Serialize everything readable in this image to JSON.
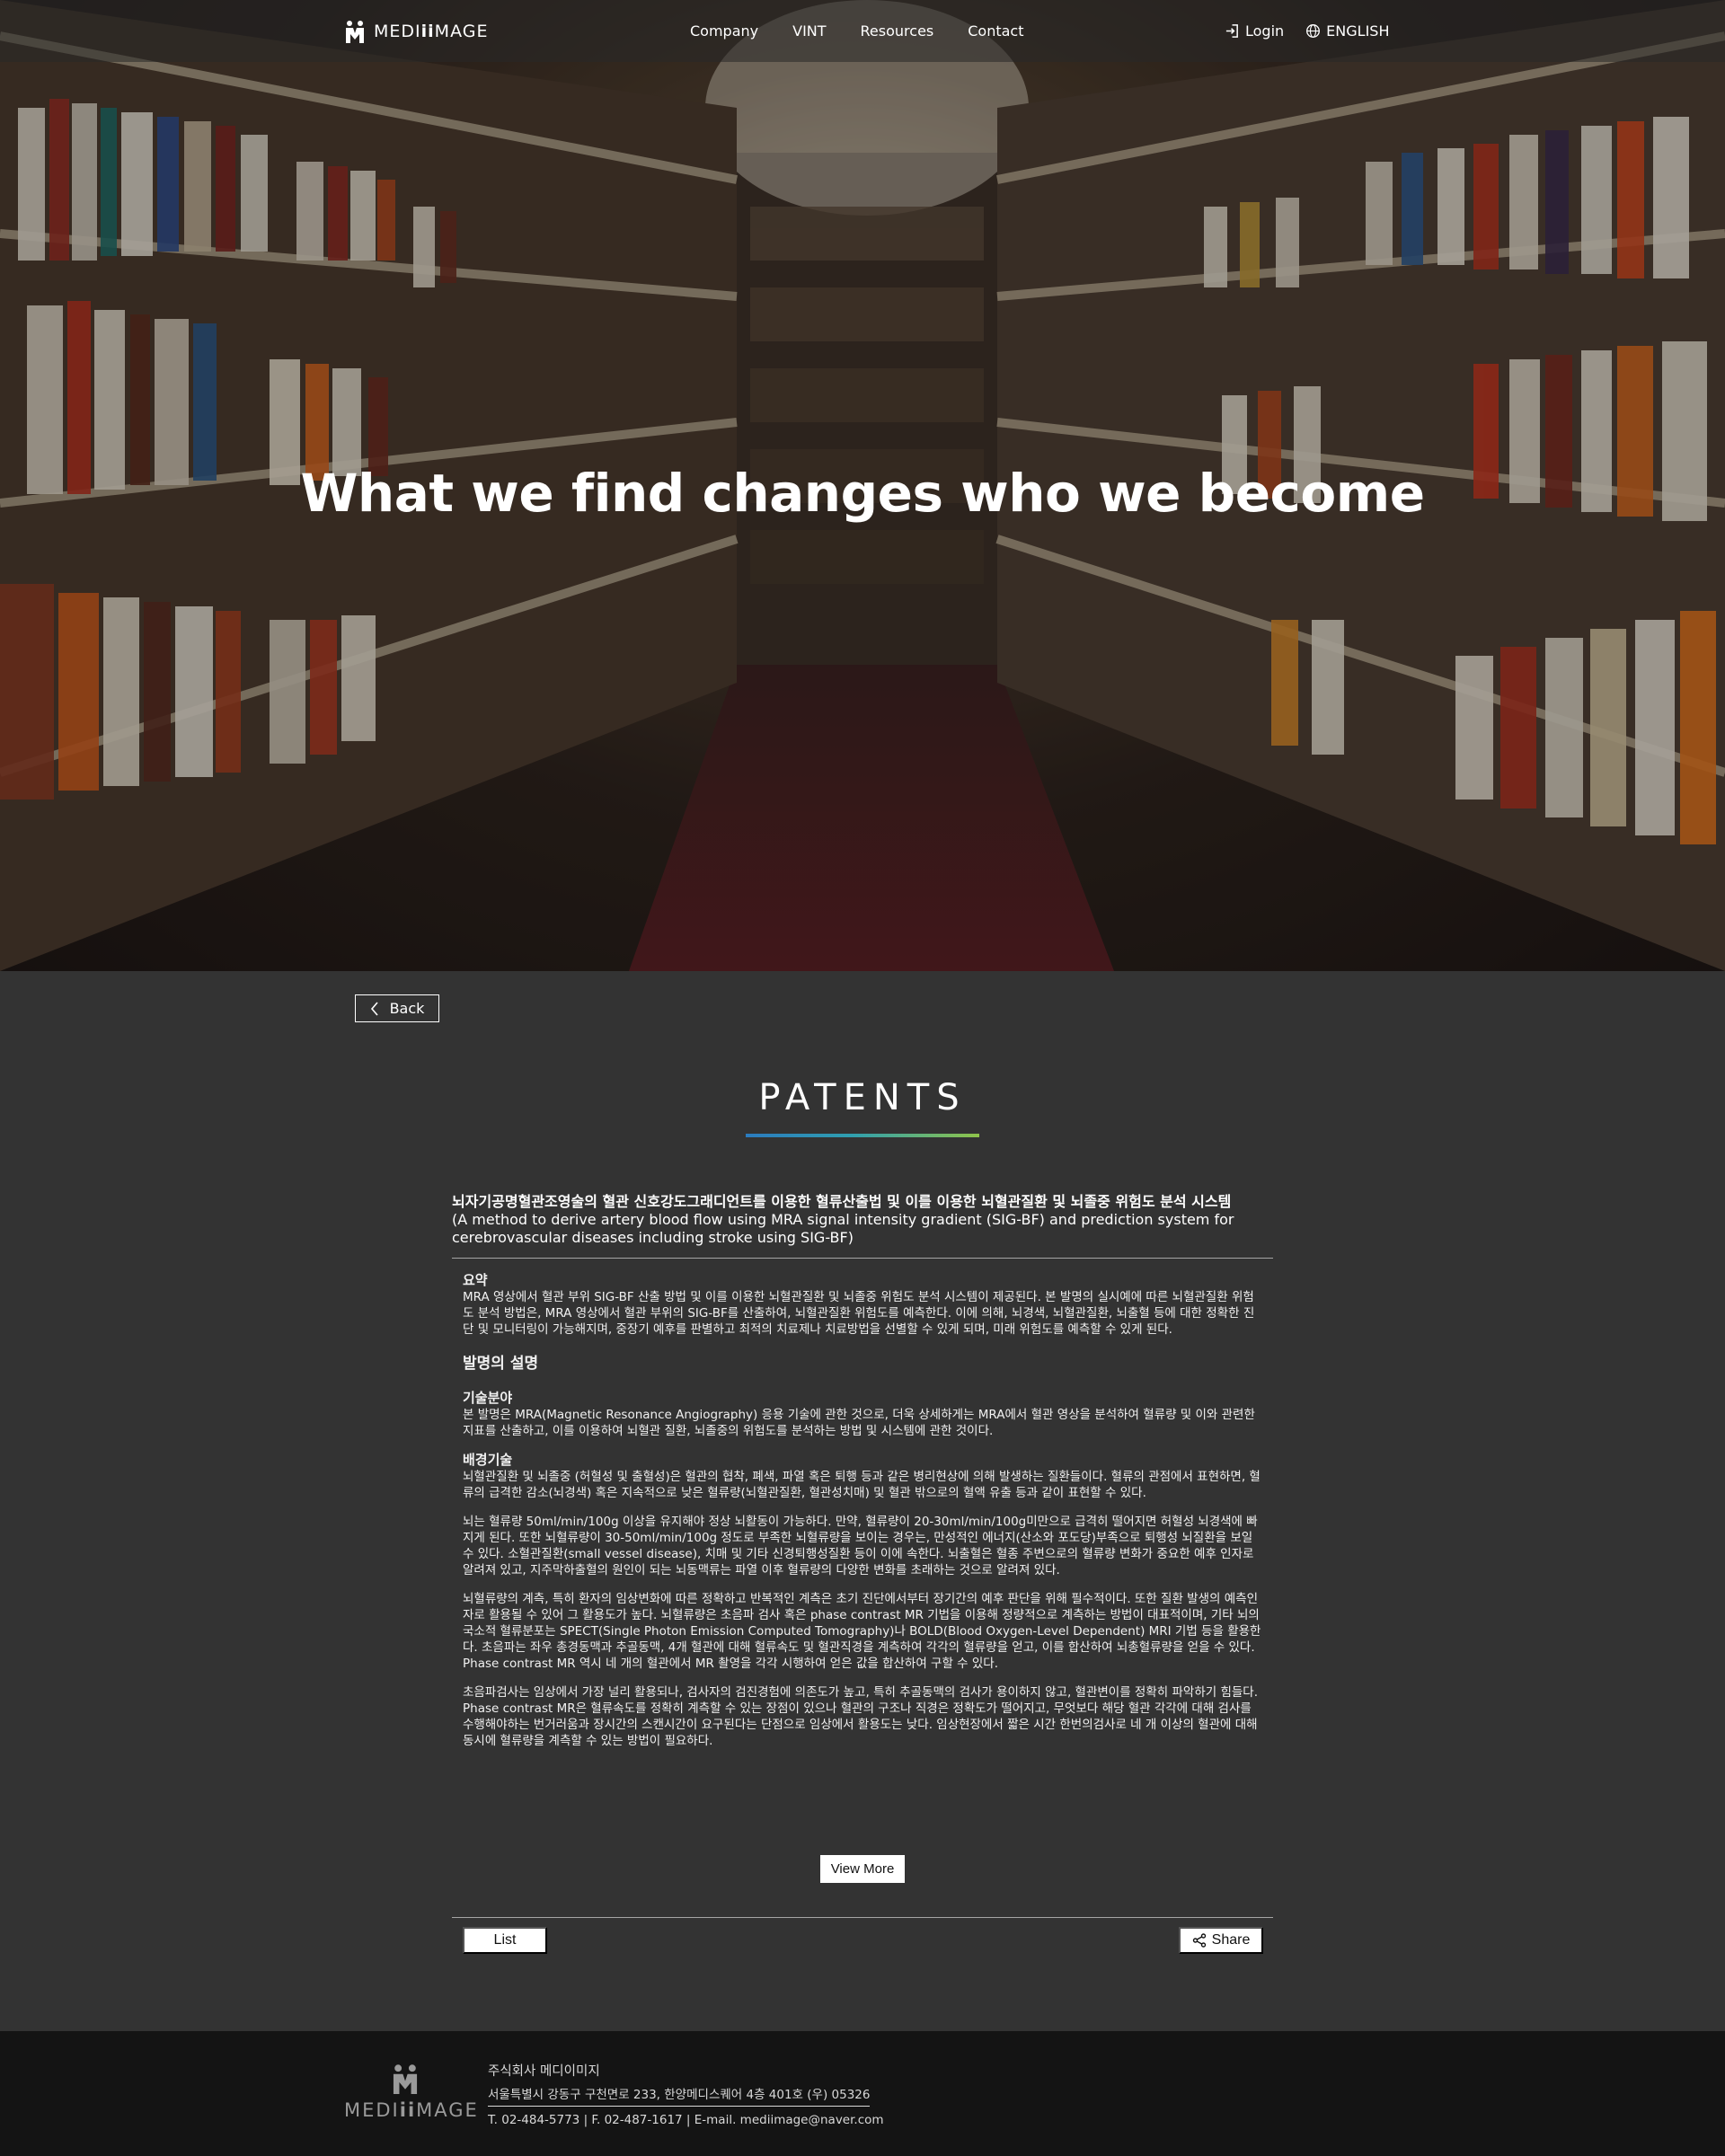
{
  "nav": {
    "logo_text_pre": "MEDI",
    "logo_text_bold": "ii",
    "logo_text_post": "MAGE",
    "links": [
      "Company",
      "VINT",
      "Resources",
      "Contact"
    ],
    "login_label": "Login",
    "language_label": "ENGLISH"
  },
  "hero": {
    "title": "What we find changes who we become"
  },
  "page": {
    "back_label": "Back",
    "section_title": "PATENTS",
    "underline_colors": [
      "#2b7bbf",
      "#2f9fb0",
      "#8fc44a"
    ]
  },
  "patent": {
    "title_ko": "뇌자기공명혈관조영술의 혈관 신호강도그래디언트를 이용한 혈류산출법 및 이를 이용한 뇌혈관질환 및 뇌졸중 위험도 분석 시스템",
    "title_en": "(A method to derive artery blood flow using MRA signal intensity gradient (SIG-BF) and prediction system for cerebrovascular diseases including stroke using SIG-BF)",
    "summary_heading": "요약",
    "summary_text": "MRA 영상에서 혈관 부위 SIG-BF 산출 방법 및 이를 이용한 뇌혈관질환 및 뇌졸중 위험도 분석 시스템이 제공된다. 본 발명의 실시예에 따른 뇌혈관질환 위험도 분석 방법은, MRA 영상에서 혈관 부위의 SIG-BF를 산출하여, 뇌혈관질환 위험도를 예측한다. 이에 의해, 뇌경색, 뇌혈관질환, 뇌출혈 등에 대한 정확한 진단 및 모니터링이 가능해지며, 중장기 예후를 판별하고 최적의 치료제나 치료방법을 선별할 수 있게 되며, 미래 위험도를 예측할 수 있게 된다.",
    "description_heading": "발명의 설명",
    "field_heading": "기술분야",
    "field_text": "본 발명은 MRA(Magnetic Resonance Angiography) 응용 기술에 관한 것으로, 더욱 상세하게는 MRA에서 혈관 영상을 분석하여 혈류량 및 이와 관련한 지표를 산출하고, 이를 이용하여 뇌혈관 질환, 뇌졸중의 위험도를 분석하는 방법 및 시스템에 관한 것이다.",
    "background_heading": "배경기술",
    "background_paragraphs": [
      "뇌혈관질환 및 뇌졸중 (허혈성 및 출혈성)은 혈관의 협착, 폐색, 파열 혹은 퇴행 등과 같은 병리현상에 의해 발생하는 질환들이다. 혈류의 관점에서 표현하면, 혈류의 급격한 감소(뇌경색) 혹은 지속적으로 낮은 혈류량(뇌혈관질환, 혈관성치매) 및 혈관 밖으로의 혈액 유출 등과 같이 표현할 수 있다.",
      "뇌는 혈류량 50ml/min/100g 이상을 유지해야 정상 뇌활동이 가능하다. 만약, 혈류량이 20-30ml/min/100g미만으로 급격히 떨어지면 허혈성 뇌경색에 빠지게 된다. 또한 뇌혈류량이 30-50ml/min/100g 정도로 부족한 뇌혈류량을 보이는 경우는, 만성적인 에너지(산소와 포도당)부족으로 퇴행성 뇌질환을 보일 수 있다. 소혈관질환(small vessel disease), 치매 및 기타 신경퇴행성질환 등이 이에 속한다. 뇌출혈은 혈종 주변으로의 혈류량 변화가 중요한 예후 인자로 알려져 있고, 지주막하출혈의 원인이 되는 뇌동맥류는 파열 이후 혈류량의 다양한 변화를 초래하는 것으로 알려져 있다.",
      "뇌혈류량의 계측, 특히 환자의 임상변화에 따른 정확하고 반복적인 계측은 초기 진단에서부터 장기간의 예후 판단을 위해 필수적이다. 또한 질환 발생의 예측인자로 활용될 수 있어 그 활용도가 높다. 뇌혈류량은 초음파 검사 혹은 phase contrast MR 기법을 이용해 정량적으로 계측하는 방법이 대표적이며, 기타 뇌의 국소적 혈류분포는 SPECT(Single Photon Emission Computed Tomography)나 BOLD(Blood Oxygen-Level Dependent) MRI 기법 등을 활용한다. 초음파는 좌우 총경동맥과 추골동맥, 4개 혈관에 대해 혈류속도 및 혈관직경을 계측하여 각각의 혈류량을 얻고, 이를 합산하여 뇌총혈류량을 얻을 수 있다. Phase contrast MR 역시 네 개의 혈관에서 MR 촬영을 각각 시행하여 얻은 값을 합산하여 구할 수 있다.",
      "초음파검사는 임상에서 가장 널리 활용되나, 검사자의 검진경험에 의존도가 높고, 특히 추골동맥의 검사가 용이하지 않고, 혈관변이를 정확히 파악하기 힘들다. Phase contrast MR은 혈류속도를 정확히 계측할 수 있는 장점이 있으나 혈관의 구조나 직경은 정확도가 떨어지고, 무엇보다 해당 혈관 각각에 대해 검사를 수행해야하는 번거러움과 장시간의 스캔시간이 요구된다는 단점으로 임상에서 활용도는 낮다. 임상현장에서 짧은 시간 한번의검사로 네 개 이상의 혈관에 대해 동시에 혈류량을 계측할 수 있는 방법이 필요하다."
    ],
    "view_more_label": "View More"
  },
  "actions": {
    "list_label": "List",
    "share_label": "Share"
  },
  "footer": {
    "logo_text_pre": "MEDI",
    "logo_text_bold": "ii",
    "logo_text_post": "MAGE",
    "company": "주식회사 메디이미지",
    "address": "서울특별시 강동구 구천면로 233, 한양메디스퀘어 4층 401호 (우) 05326",
    "contact": "T. 02-484-5773 | F. 02-487-1617 | E-mail. mediimage@naver.com"
  }
}
